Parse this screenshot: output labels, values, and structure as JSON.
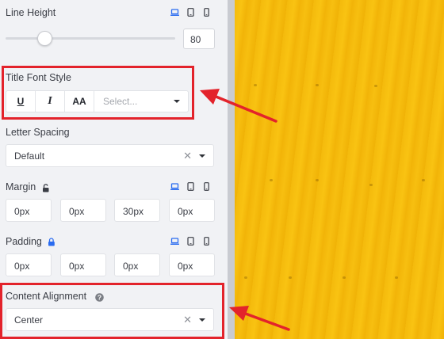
{
  "line_height": {
    "label": "Line Height",
    "value": "80",
    "slider_fraction": 0.23
  },
  "title_font_style": {
    "label": "Title Font Style",
    "underline_label": "U",
    "italic_label": "I",
    "uppercase_label": "AA",
    "select_placeholder": "Select..."
  },
  "letter_spacing": {
    "label": "Letter Spacing",
    "value": "Default"
  },
  "margin": {
    "label": "Margin",
    "lock_icon": "unlocked-lock-icon",
    "values": [
      "0px",
      "0px",
      "30px",
      "0px"
    ]
  },
  "padding": {
    "label": "Padding",
    "lock_icon": "locked-lock-icon",
    "values": [
      "0px",
      "0px",
      "0px",
      "0px"
    ]
  },
  "content_alignment": {
    "label": "Content Alignment",
    "value": "Center"
  },
  "responsive_icons": [
    "desktop-icon",
    "tablet-icon",
    "mobile-icon"
  ],
  "colors": {
    "panel": "#f1f2f5",
    "accent_blue": "#2a6cf0",
    "highlight_red": "#e3232b",
    "canvas_yellow": "#f7bf10"
  }
}
